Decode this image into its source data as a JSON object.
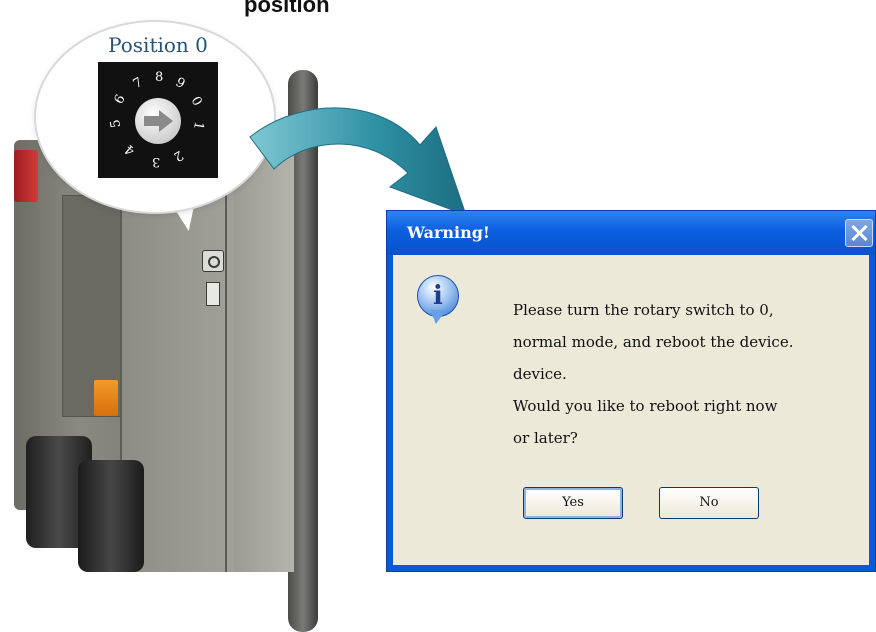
{
  "heading_fragment": "position",
  "callout": {
    "title": "Position 0",
    "dial_digits": [
      "6",
      "7",
      "8",
      "9",
      "0",
      "1",
      "2",
      "3",
      "4",
      "5"
    ]
  },
  "dialog": {
    "title": "Warning!",
    "message_lines": [
      "Please turn the rotary switch to 0,",
      "normal mode, and reboot the device.",
      "device.",
      "Would you like to reboot right now",
      "or later?"
    ],
    "buttons": {
      "yes": "Yes",
      "no": "No"
    },
    "icon": "info-icon"
  },
  "colors": {
    "title_bar": "#0b5fe0",
    "dialog_face": "#ece9d8",
    "arrow": "#2e8fa3",
    "callout_title": "#26537a"
  }
}
